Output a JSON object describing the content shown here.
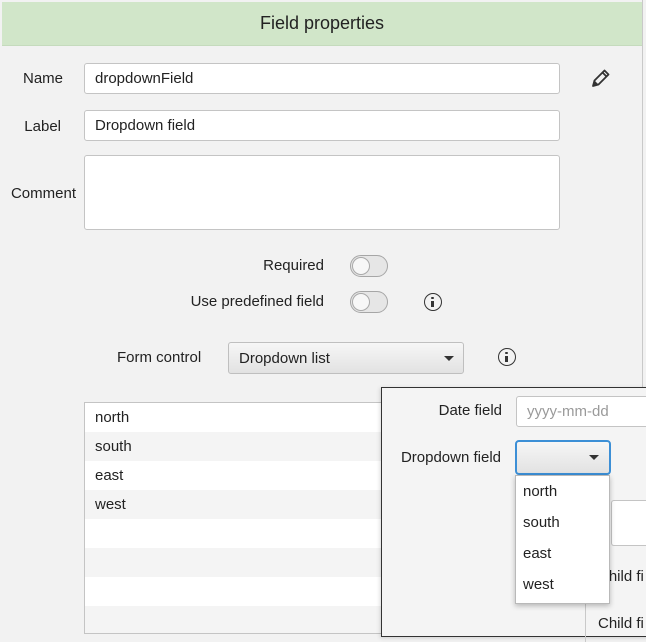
{
  "header": {
    "title": "Field properties"
  },
  "name": {
    "label": "Name",
    "value": "dropdownField"
  },
  "label_field": {
    "label": "Label",
    "value": "Dropdown field"
  },
  "comment": {
    "label": "Comment",
    "value": ""
  },
  "required": {
    "label": "Required",
    "on": false
  },
  "predefined": {
    "label": "Use predefined field",
    "on": false
  },
  "form_control": {
    "label": "Form control",
    "selected": "Dropdown list"
  },
  "options": [
    "north",
    "south",
    "east",
    "west"
  ],
  "preview": {
    "date_label": "Date field",
    "date_placeholder": "yyyy-mm-dd",
    "dropdown_label": "Dropdown field",
    "dropdown_value": "",
    "popup_options": [
      "north",
      "south",
      "east",
      "west"
    ],
    "child_1": "Child fi",
    "child_2": "Child fi"
  },
  "colors": {
    "header_bg": "#d1e6c9",
    "focus": "#3c8fd6"
  },
  "icons": {
    "edit": "pencil-icon",
    "info": "info-icon",
    "caret": "chevron-down-icon"
  }
}
